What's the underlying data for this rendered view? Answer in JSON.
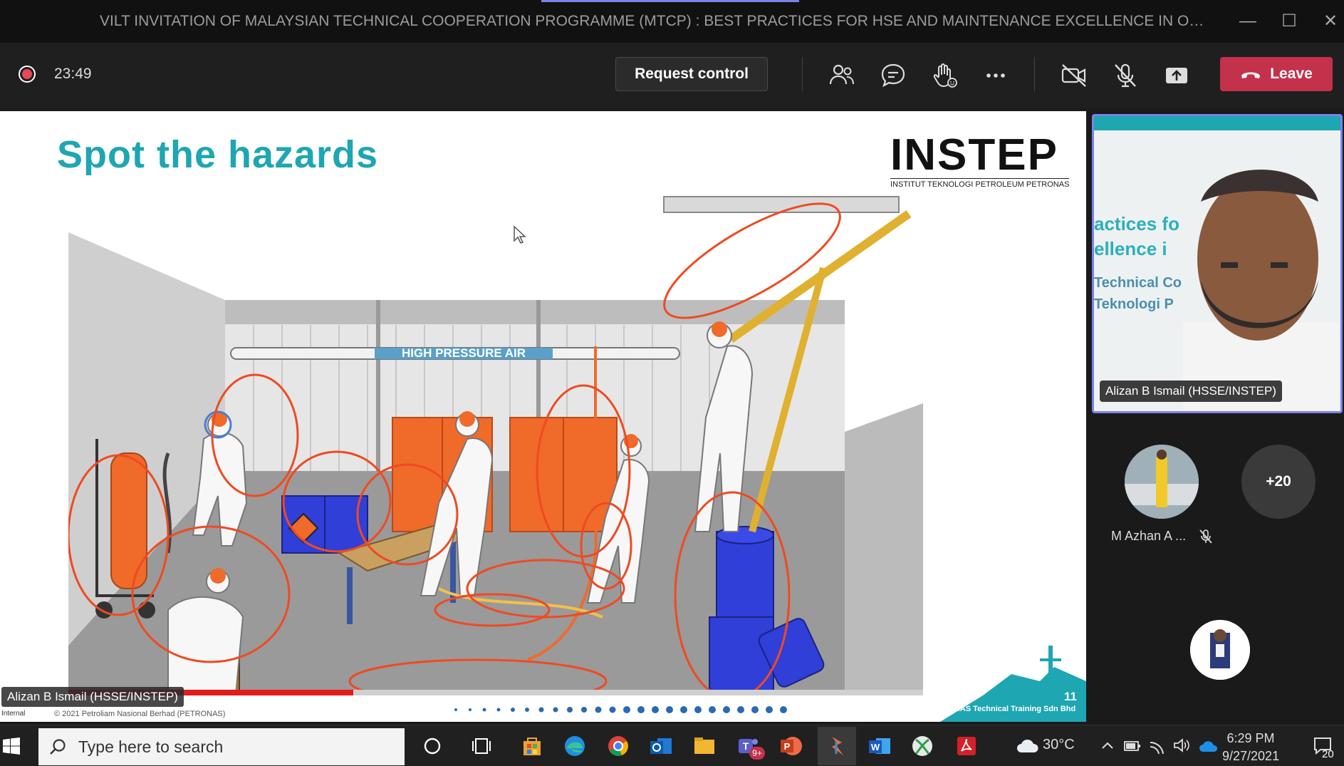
{
  "window": {
    "title": "VILT INVITATION OF MALAYSIAN TECHNICAL COOPERATION PROGRAMME (MTCP) : BEST PRACTICES FOR HSE AND MAINTENANCE EXCELLENCE IN O&G IND...",
    "accent_color": "#7b83eb"
  },
  "toolbar": {
    "recording_indicator": "record-icon",
    "timer": "23:49",
    "request_control_label": "Request control",
    "icons": [
      "participants-icon",
      "chat-icon",
      "raise-hand-icon",
      "more-icon",
      "camera-off-icon",
      "mic-off-icon",
      "share-icon"
    ],
    "leave_label": "Leave",
    "leave_color": "#c4314b"
  },
  "slide": {
    "title": "Spot the hazards",
    "logo_word": "INSTEP",
    "logo_subtitle": "INSTITUT TEKNOLOGI PETROLEUM PETRONAS",
    "scene_sign": "HIGH PRESSURE AIR",
    "page_number": "11",
    "copyright": "© 2021 Petroliam Nasional Berhad (PETRONAS)",
    "classification": "Internal",
    "footer_brand": "PETRONAS Technical Training Sdn Bhd",
    "title_color": "#1ea6b2"
  },
  "presenter_label": "Alizan B Ismail (HSSE/INSTEP)",
  "participants": {
    "video_name": "Alizan B Ismail (HSSE/INSTEP)",
    "video_background_text": [
      "actices fo",
      "ellence i",
      "Technical Co",
      "Teknologi P"
    ],
    "tile_name": "M Azhan A ...",
    "more_count": "+20"
  },
  "taskbar": {
    "search_placeholder": "Type here to search",
    "apps": [
      "cortana-icon",
      "task-view-icon",
      "store-icon",
      "edge-icon",
      "chrome-icon",
      "outlook-icon",
      "file-explorer-icon",
      "teams-icon",
      "powerpoint-icon",
      "app-icon",
      "word-icon",
      "xbox-icon",
      "acrobat-icon"
    ],
    "teams_badge": "9+",
    "temperature": "30°C",
    "time": "6:29 PM",
    "date": "9/27/2021",
    "notification_count": "20"
  }
}
